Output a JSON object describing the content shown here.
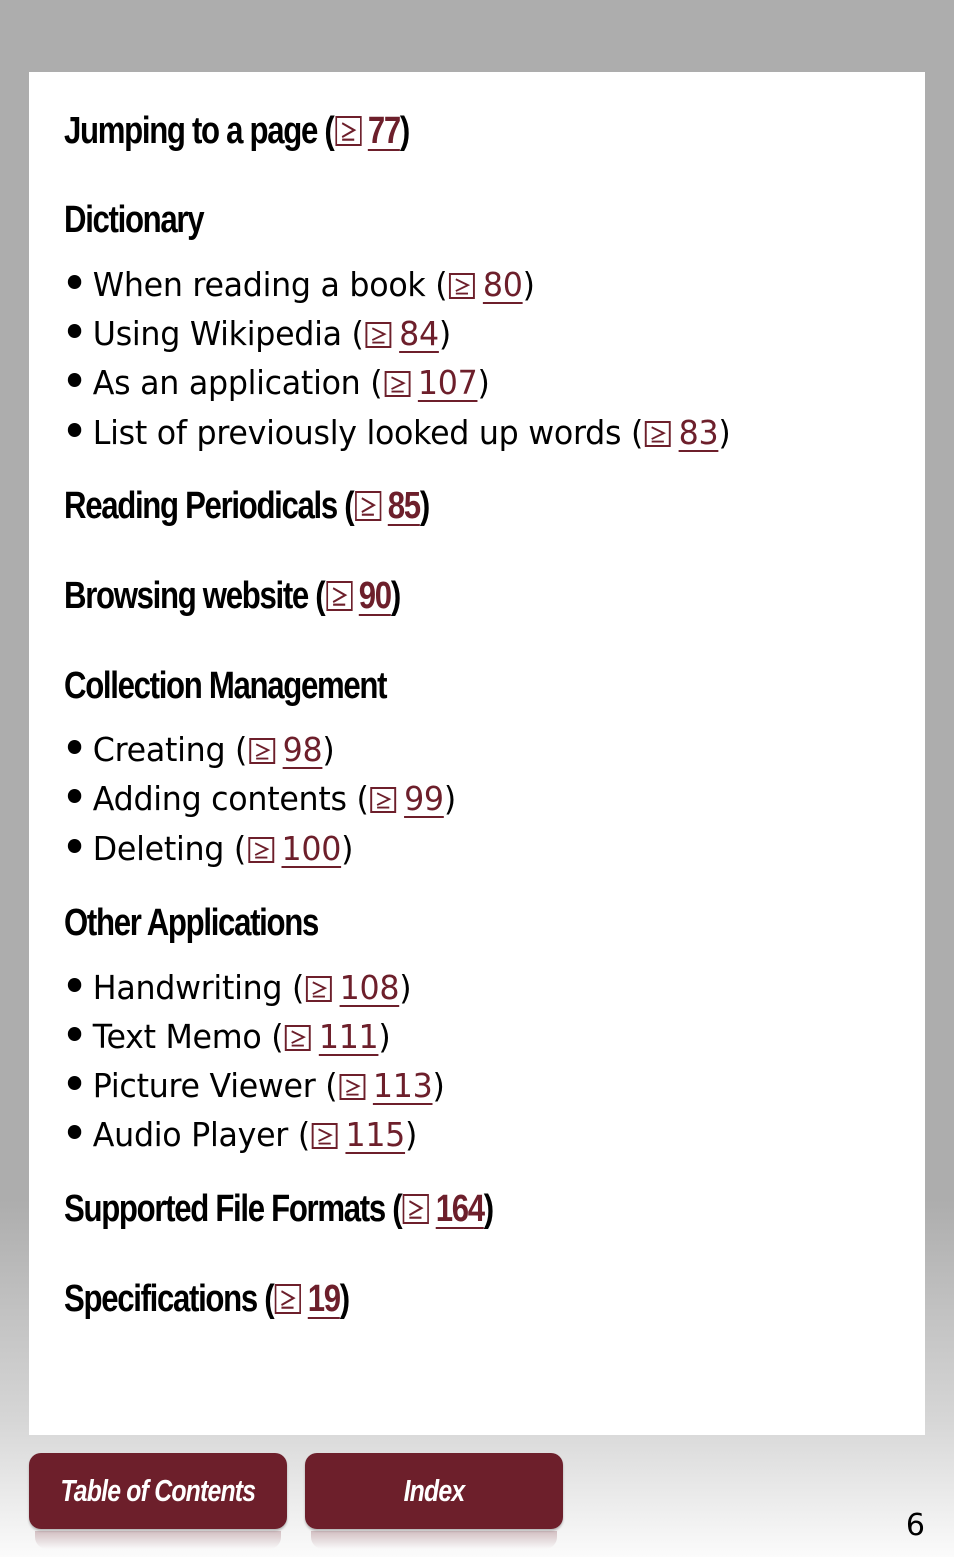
{
  "colors": {
    "accent": "#6d1f2b",
    "frame": "#adadad",
    "page": "#ffffff"
  },
  "sections": [
    {
      "title": "Jumping to a page",
      "ref_icon": "go-to-page-icon",
      "page": "77"
    },
    {
      "title": "Dictionary",
      "items": [
        {
          "label": "When reading a book",
          "page": "80"
        },
        {
          "label": "Using Wikipedia",
          "page": "84"
        },
        {
          "label": "As an application",
          "page": "107"
        },
        {
          "label": "List of previously looked up words",
          "page": "83"
        }
      ]
    },
    {
      "title": "Reading Periodicals",
      "page": "85"
    },
    {
      "title": "Browsing website",
      "page": "90"
    },
    {
      "title": "Collection Management",
      "items": [
        {
          "label": "Creating",
          "page": "98"
        },
        {
          "label": "Adding contents",
          "page": "99"
        },
        {
          "label": "Deleting",
          "page": "100"
        }
      ]
    },
    {
      "title": "Other Applications",
      "items": [
        {
          "label": "Handwriting",
          "page": "108"
        },
        {
          "label": "Text Memo",
          "page": "111"
        },
        {
          "label": "Picture Viewer",
          "page": "113"
        },
        {
          "label": "Audio Player",
          "page": "115"
        }
      ]
    },
    {
      "title": "Supported File Formats",
      "page": "164"
    },
    {
      "title": "Specifications",
      "page": "19"
    }
  ],
  "punct": {
    "open": "(",
    "close": ")"
  },
  "footer": {
    "toc_label": "Table of Contents",
    "index_label": "Index",
    "page_number": "6"
  }
}
